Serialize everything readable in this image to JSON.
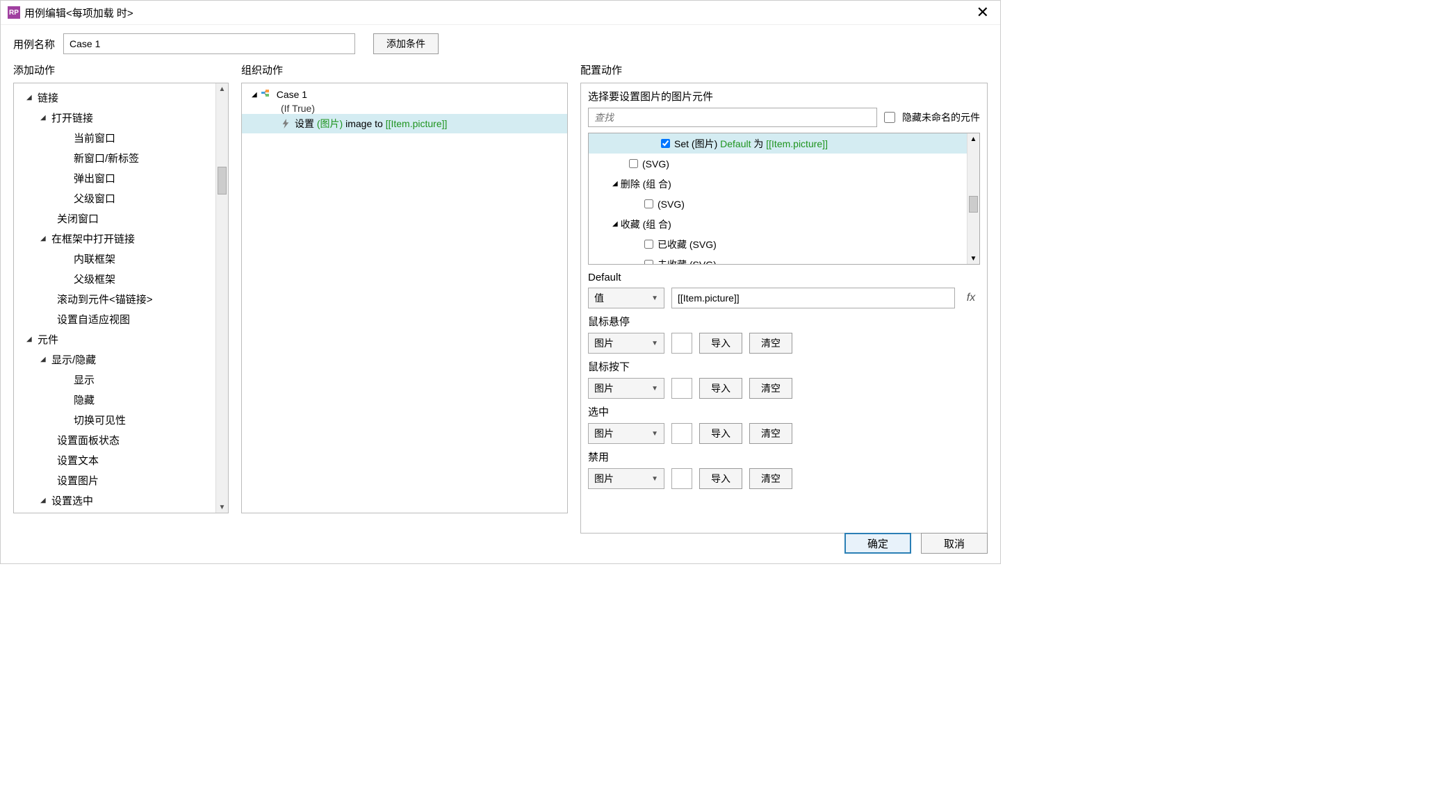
{
  "titlebar": {
    "app_icon_text": "RP",
    "title": "用例编辑<每项加载 时>"
  },
  "top": {
    "case_name_label": "用例名称",
    "case_name_value": "Case 1",
    "add_condition_label": "添加条件"
  },
  "headers": {
    "add_action": "添加动作",
    "organize_action": "组织动作",
    "configure_action": "配置动作"
  },
  "left_tree": {
    "links": "链接",
    "open_link": "打开链接",
    "current_window": "当前窗口",
    "new_window": "新窗口/新标签",
    "popup_window": "弹出窗口",
    "parent_window": "父级窗口",
    "close_window": "关闭窗口",
    "open_in_frame": "在框架中打开链接",
    "inline_frame": "内联框架",
    "parent_frame": "父级框架",
    "scroll_to": "滚动到元件<锚链接>",
    "set_adaptive": "设置自适应视图",
    "widgets": "元件",
    "show_hide": "显示/隐藏",
    "show": "显示",
    "hide": "隐藏",
    "toggle": "切换可见性",
    "set_panel_state": "设置面板状态",
    "set_text": "设置文本",
    "set_image": "设置图片",
    "set_selected": "设置选中"
  },
  "mid": {
    "case_name": "Case 1",
    "if_true": "(If True)",
    "action_prefix": "设置 ",
    "action_green1": "(图片)",
    "action_mid": " image to ",
    "action_green2": "[[Item.picture]]"
  },
  "right": {
    "choose_widget_title": "选择要设置图片的图片元件",
    "search_placeholder": "查找",
    "hide_unnamed_label": "隐藏未命名的元件",
    "tree": {
      "row1_pre": "Set (图片) ",
      "row1_green1": "Default",
      "row1_mid": " 为 ",
      "row1_green2": "[[Item.picture]]",
      "row2": "(SVG)",
      "row3": "删除 (组 合)",
      "row4": "(SVG)",
      "row5": "收藏 (组 合)",
      "row6": "已收藏 (SVG)",
      "row7": "未收藏 (SVG)"
    },
    "default_section": {
      "label": "Default",
      "select_value": "值",
      "input_value": "[[Item.picture]]"
    },
    "hover": {
      "label": "鼠标悬停",
      "select_value": "图片",
      "import": "导入",
      "clear": "清空"
    },
    "mousedown": {
      "label": "鼠标按下",
      "select_value": "图片",
      "import": "导入",
      "clear": "清空"
    },
    "selected": {
      "label": "选中",
      "select_value": "图片",
      "import": "导入",
      "clear": "清空"
    },
    "disabled": {
      "label": "禁用",
      "select_value": "图片",
      "import": "导入",
      "clear": "清空"
    }
  },
  "footer": {
    "ok": "确定",
    "cancel": "取消"
  }
}
